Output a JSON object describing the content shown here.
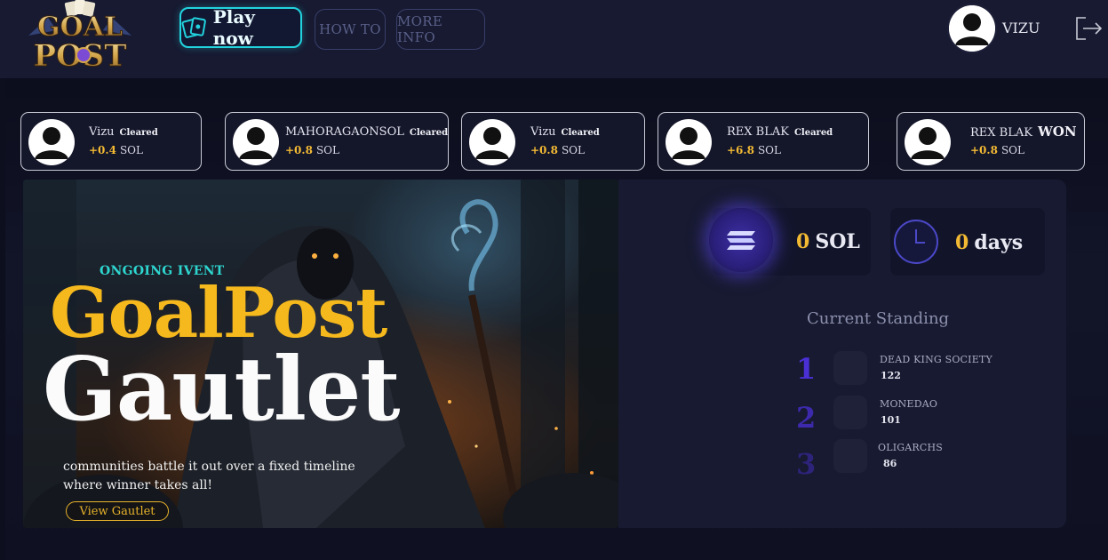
{
  "brand": {
    "logo_text_top": "GOAL",
    "logo_text_bottom": "POST"
  },
  "nav": {
    "play_label": "Play now",
    "howto_label": "HOW TO",
    "moreinfo_label": "MORE INFO"
  },
  "user": {
    "name": "VIZU"
  },
  "activity": [
    {
      "name": "Vizu",
      "status": "Cleared",
      "amount": "+0.4",
      "unit": "SOL"
    },
    {
      "name": "MAHORAGAONSOL",
      "status": "Cleared",
      "amount": "+0.8",
      "unit": "SOL"
    },
    {
      "name": "Vizu",
      "status": "Cleared",
      "amount": "+0.8",
      "unit": "SOL"
    },
    {
      "name": "REX BLAK",
      "status": "Cleared",
      "amount": "+6.8",
      "unit": "SOL"
    },
    {
      "name": "REX BLAK",
      "status": "WON",
      "amount": "+0.8",
      "unit": "SOL"
    }
  ],
  "hero": {
    "tag": "ONGOING IVENT",
    "title_line1": "GoalPost",
    "title_line2": "Gautlet",
    "description": "communities battle it out over a fixed timeline where winner takes all!",
    "cta_label": "View Gautlet"
  },
  "stats": {
    "prize_value": "0",
    "prize_unit": "SOL",
    "time_value": "0",
    "time_unit": "days"
  },
  "standing": {
    "title": "Current Standing",
    "entries": [
      {
        "rank": "1",
        "team": "DEAD KING SOCIETY",
        "score": "122"
      },
      {
        "rank": "2",
        "team": "MONEDAO",
        "score": "101"
      },
      {
        "rank": "3",
        "team": "OLIGARCHS",
        "score": "86"
      }
    ]
  },
  "colors": {
    "accent_cyan": "#22d3de",
    "accent_gold": "#f2b933",
    "rank_purple": "#4a2fd6",
    "background": "#0d0f1f"
  },
  "icons": [
    "cards-icon",
    "logout-icon",
    "solana-icon",
    "clock-icon",
    "avatar-icon"
  ]
}
